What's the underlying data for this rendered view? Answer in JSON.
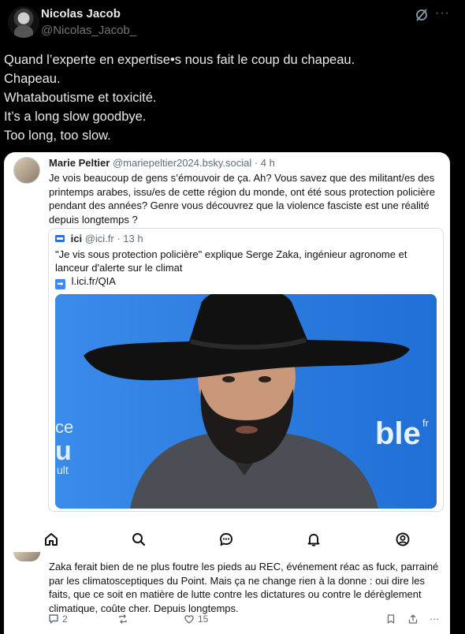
{
  "post": {
    "author_name": "Nicolas Jacob",
    "author_handle": "@Nicolas_Jacob_",
    "text_lines": [
      "Quand l’experte en expertise•s nous fait le coup du chapeau.",
      "Chapeau.",
      "Whataboutisme et toxicité.",
      "It’s a long slow goodbye.",
      "Too long, too slow."
    ]
  },
  "quoted": {
    "author_name": "Marie Peltier",
    "author_handle": "@mariepeltier2024.bsky.social · 4 h",
    "text": "Je vois beaucoup de gens s’émouvoir de ça. Ah? Vous savez que des militant/es des printemps arabes, issu/es de cette région du monde, ont été sous protection policière pendant des années? Genre vous découvrez que la violence fasciste est une réalité depuis longtemps ?",
    "inner": {
      "author_name": "ici",
      "author_handle": "@ici.fr · 13 h",
      "text": "\"Je vis sous protection policière\" explique Serge Zaka, ingénieur agronome et lanceur d'alerte sur le climat",
      "link_text": "l.ici.fr/QIA",
      "link_icon": "➡",
      "photo_backdrop": [
        "ce",
        "u",
        "ult",
        "ble",
        "fr"
      ]
    }
  },
  "nav": {
    "items": [
      "home-icon",
      "search-icon",
      "chat-icon",
      "bell-icon",
      "profile-icon"
    ]
  },
  "reply": {
    "text": "Zaka ferait bien de ne plus foutre les pieds au REC, événement réac as fuck, parrainé par les climatosceptiques du Point. Mais ça ne change rien à la donne : oui dire les faits, que ce soit en matière de lutte contre les dictatures ou contre le dérèglement climatique, coûte cher. Depuis longtemps.",
    "reply_count": "2",
    "like_count": "15"
  },
  "colors": {
    "background": "#000000",
    "text_primary": "#e7e9ea",
    "text_secondary": "#71767b",
    "card_bg": "#ffffff",
    "bsky_gray": "#5f6e7e",
    "photo_blue": "#2f7fe0"
  }
}
